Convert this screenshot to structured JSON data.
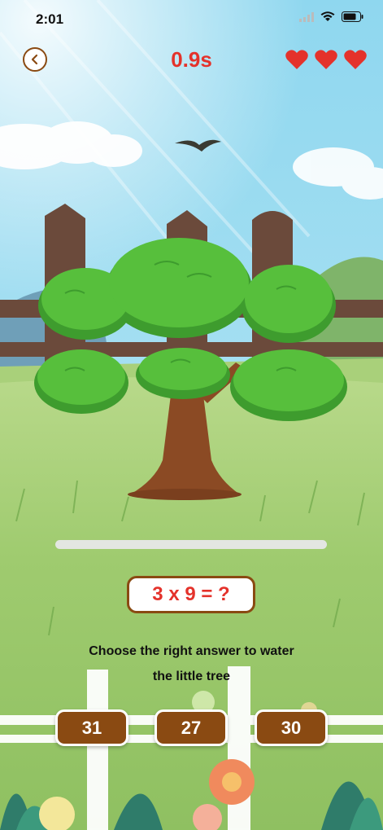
{
  "status_bar": {
    "time": "2:01",
    "icons": [
      "cellular-icon",
      "wifi-icon",
      "battery-icon"
    ]
  },
  "header": {
    "back_icon": "chevron-left-icon",
    "timer": "0.9s",
    "lives": 3,
    "life_icon": "heart-icon"
  },
  "game": {
    "progress": 0.0,
    "question": "3 x 9 = ?",
    "instruction_line1": "Choose the right answer to water",
    "instruction_line2": "the little tree",
    "answers": [
      "31",
      "27",
      "30"
    ]
  },
  "colors": {
    "accent_brown": "#8a4a12",
    "timer_red": "#e4322b",
    "heart_red": "#e4322b",
    "grass_green": "#94c46a",
    "sky_blue": "#7fd0ec"
  }
}
